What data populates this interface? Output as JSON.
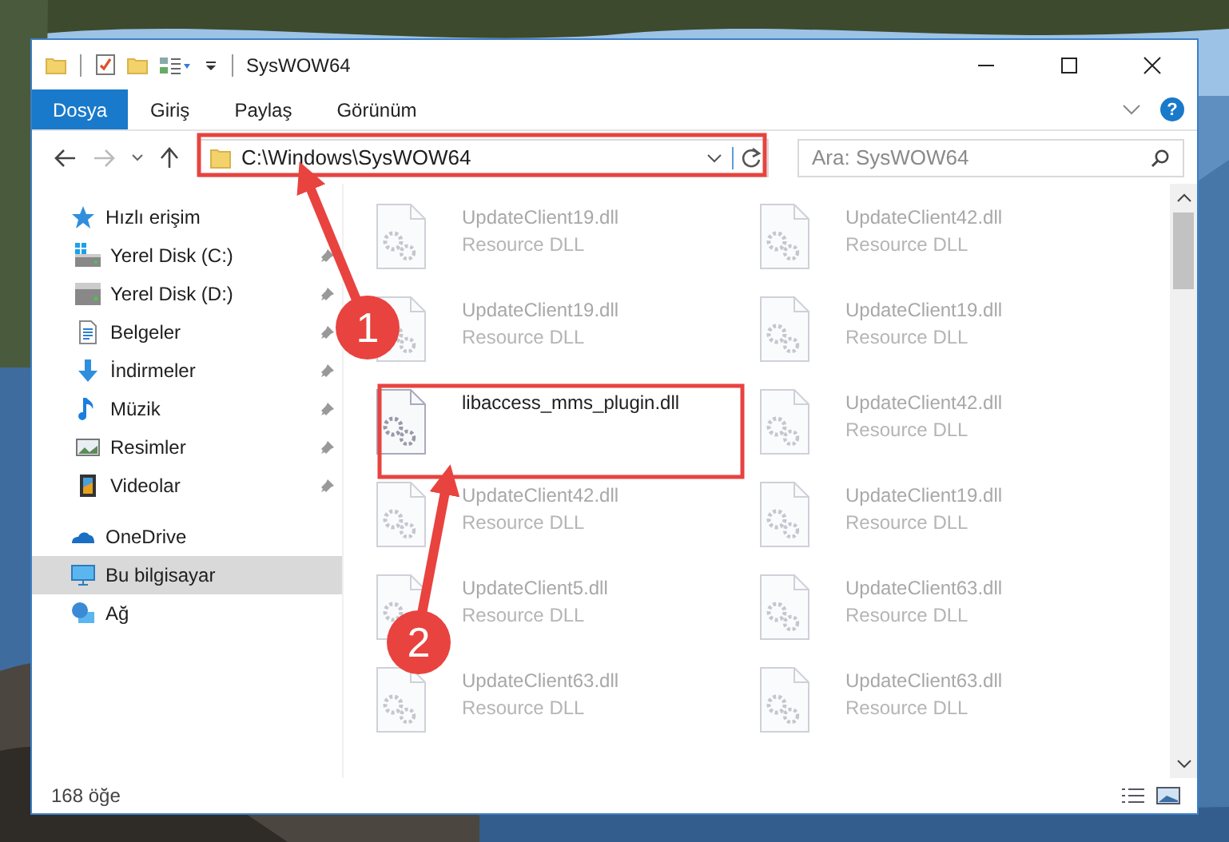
{
  "window": {
    "title": "SysWOW64"
  },
  "ribbon": {
    "tabs": [
      {
        "label": "Dosya",
        "selected": true
      },
      {
        "label": "Giriş",
        "selected": false
      },
      {
        "label": "Paylaş",
        "selected": false
      },
      {
        "label": "Görünüm",
        "selected": false
      }
    ],
    "help": "?"
  },
  "address_bar": {
    "path": "C:\\Windows\\SysWOW64",
    "search_placeholder": "Ara: SysWOW64"
  },
  "nav_pane": {
    "items": [
      {
        "label": "Hızlı erişim",
        "kind": "star",
        "selected": false,
        "children": [
          {
            "label": "Yerel Disk (C:)",
            "kind": "windrive",
            "pinned": true,
            "selected": false
          },
          {
            "label": "Yerel Disk (D:)",
            "kind": "drive",
            "pinned": true,
            "selected": false
          },
          {
            "label": "Belgeler",
            "kind": "docs",
            "pinned": true,
            "selected": false
          },
          {
            "label": "İndirmeler",
            "kind": "download",
            "pinned": true,
            "selected": false
          },
          {
            "label": "Müzik",
            "kind": "music",
            "pinned": true,
            "selected": false
          },
          {
            "label": "Resimler",
            "kind": "pictures",
            "pinned": true,
            "selected": false
          },
          {
            "label": "Videolar",
            "kind": "videos",
            "pinned": true,
            "selected": false
          }
        ]
      },
      {
        "label": "OneDrive",
        "kind": "cloud",
        "selected": false
      },
      {
        "label": "Bu bilgisayar",
        "kind": "pc",
        "selected": true
      },
      {
        "label": "Ağ",
        "kind": "network",
        "selected": false
      }
    ]
  },
  "files": [
    {
      "name": "UpdateClient19.dll",
      "type": "Resource DLL",
      "blurred": true
    },
    {
      "name": "UpdateClient42.dll",
      "type": "Resource DLL",
      "blurred": true
    },
    {
      "name": "UpdateClient19.dll",
      "type": "Resource DLL",
      "blurred": true
    },
    {
      "name": "UpdateClient19.dll",
      "type": "Resource DLL",
      "blurred": true
    },
    {
      "name": "libaccess_mms_plugin.dll",
      "blurred": false
    },
    {
      "name": "UpdateClient42.dll",
      "type": "Resource DLL",
      "blurred": true
    },
    {
      "name": "UpdateClient42.dll",
      "type": "Resource DLL",
      "blurred": true
    },
    {
      "name": "UpdateClient19.dll",
      "type": "Resource DLL",
      "blurred": true
    },
    {
      "name": "UpdateClient5.dll",
      "type": "Resource DLL",
      "blurred": true
    },
    {
      "name": "UpdateClient63.dll",
      "type": "Resource DLL",
      "blurred": true
    },
    {
      "name": "UpdateClient63.dll",
      "type": "Resource DLL",
      "blurred": true
    },
    {
      "name": "UpdateClient63.dll",
      "type": "Resource DLL",
      "blurred": true
    }
  ],
  "status_bar": {
    "count": "168 öğe"
  },
  "annotations": [
    {
      "label": "1"
    },
    {
      "label": "2"
    }
  ]
}
